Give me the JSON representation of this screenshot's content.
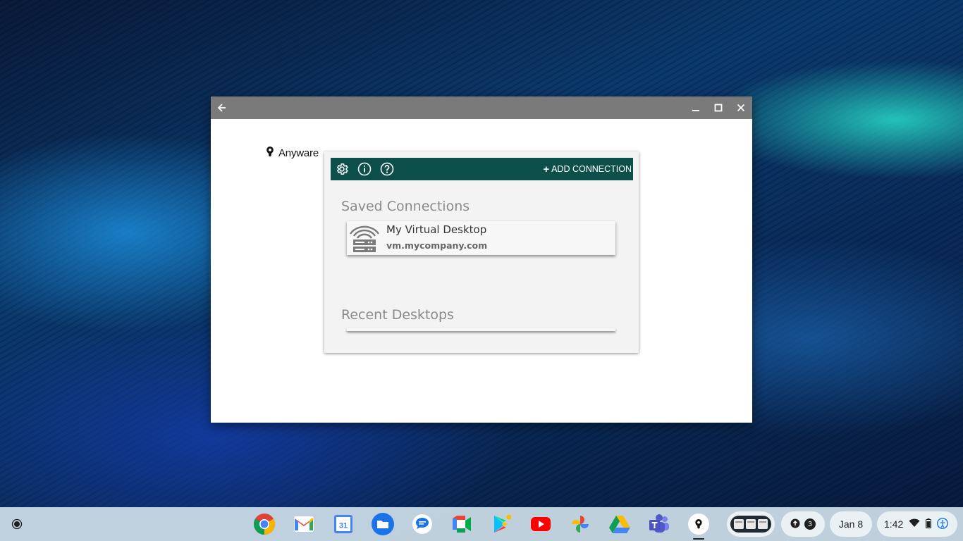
{
  "window": {
    "back_icon": "arrow-left-icon",
    "minimize_icon": "minimize-icon",
    "maximize_icon": "maximize-icon",
    "close_icon": "close-icon"
  },
  "brand": {
    "name": "Anyware",
    "logo_icon": "anyware-logo-icon"
  },
  "toolbar": {
    "settings_icon": "gear-icon",
    "info_icon": "info-icon",
    "help_icon": "help-icon",
    "add_connection_label": "ADD CONNECTION",
    "accent_color": "#0d4f4b"
  },
  "saved_connections": {
    "title": "Saved Connections",
    "items": [
      {
        "name": "My Virtual Desktop",
        "host": "vm.mycompany.com",
        "icon": "server-signal-icon"
      }
    ]
  },
  "recent_desktops": {
    "title": "Recent Desktops",
    "items": []
  },
  "shelf": {
    "apps": [
      {
        "name": "Chrome",
        "icon": "chrome-icon"
      },
      {
        "name": "Gmail",
        "icon": "gmail-icon"
      },
      {
        "name": "Calendar",
        "icon": "calendar-icon",
        "label": "31"
      },
      {
        "name": "Files",
        "icon": "files-icon"
      },
      {
        "name": "Messages",
        "icon": "messages-icon"
      },
      {
        "name": "Meet",
        "icon": "meet-icon"
      },
      {
        "name": "Play Store",
        "icon": "play-store-icon"
      },
      {
        "name": "YouTube",
        "icon": "youtube-icon"
      },
      {
        "name": "Photos",
        "icon": "photos-icon"
      },
      {
        "name": "Drive",
        "icon": "drive-icon"
      },
      {
        "name": "Teams",
        "icon": "teams-icon"
      },
      {
        "name": "Anyware",
        "icon": "anyware-logo-icon"
      }
    ],
    "notification_count": "3",
    "date": "Jan 8",
    "time": "1:42"
  }
}
